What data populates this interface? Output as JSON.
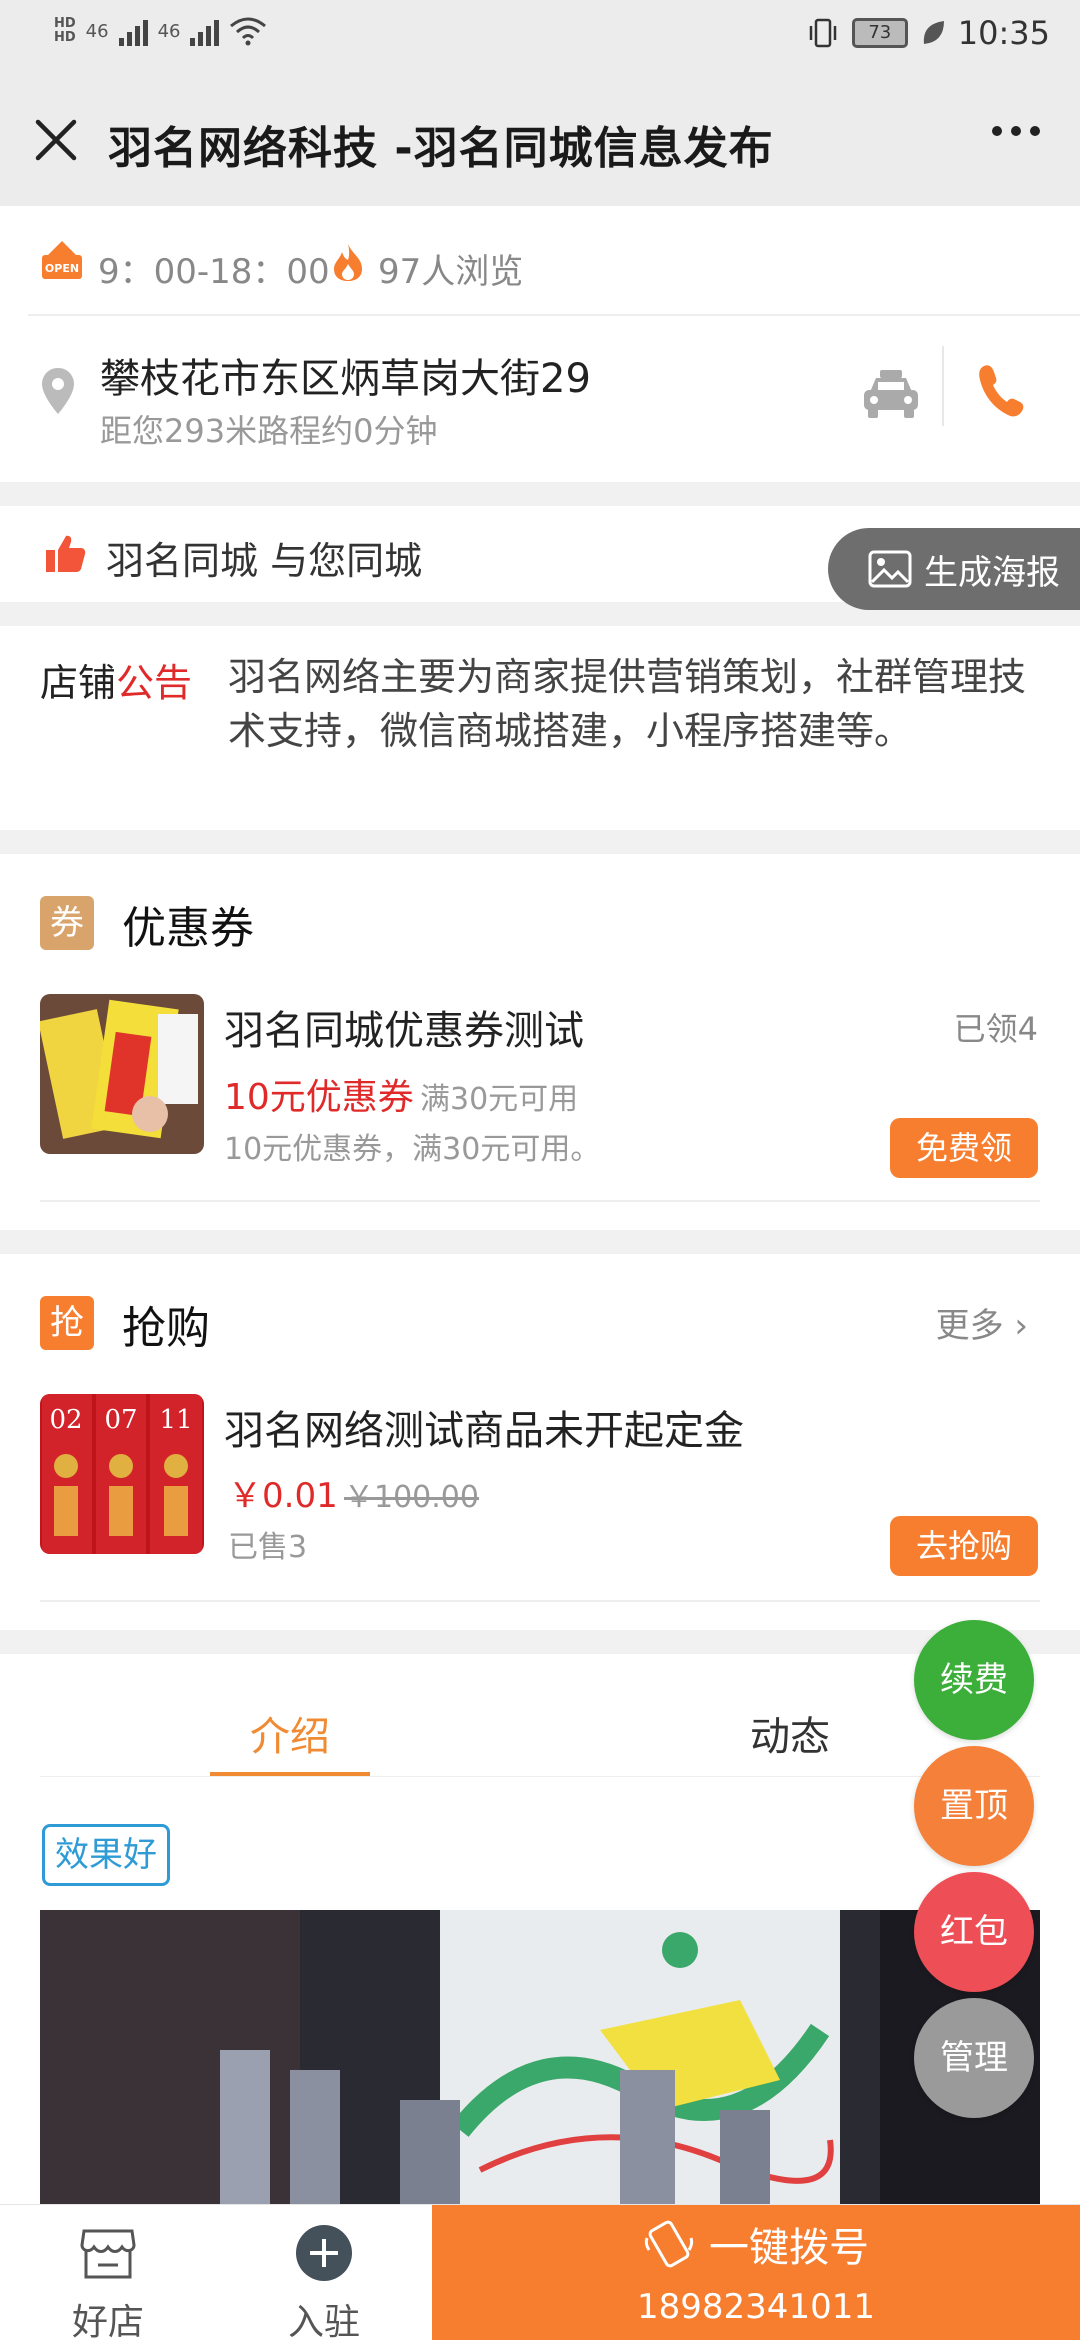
{
  "status_bar": {
    "signal_1": "46",
    "signal_2": "46",
    "battery": "73",
    "time": "10:35"
  },
  "nav": {
    "title": "羽名网络科技 -羽名同城信息发布"
  },
  "shop": {
    "open_badge": "OPEN",
    "hours": "9：00-18：00",
    "views": "97人浏览",
    "address": "攀枝花市东区炳草岗大街29",
    "distance": "距您293米路程约0分钟",
    "slogan": "羽名同城 与您同城",
    "poster_button": "生成海报",
    "notice_label_1": "店铺",
    "notice_label_2": "公告",
    "notice_text": "羽名网络主要为商家提供营销策划，社群管理技术支持，微信商城搭建，小程序搭建等。"
  },
  "coupon_section": {
    "badge": "券",
    "title": "优惠券",
    "item": {
      "name": "羽名同城优惠券测试",
      "claimed": "已领4",
      "amount": "10元优惠券",
      "condition": "满30元可用",
      "description": "10元优惠券，满30元可用。",
      "button": "免费领"
    }
  },
  "flash_section": {
    "badge": "抢",
    "title": "抢购",
    "more": "更多",
    "item": {
      "name": "羽名网络测试商品未开起定金",
      "price": "￥0.01",
      "old_price": "￥100.00",
      "sold": "已售3",
      "button": "去抢购"
    }
  },
  "tabs": [
    "介绍",
    "动态"
  ],
  "intro": {
    "tag": "效果好"
  },
  "fabs": {
    "renew": "续费",
    "top": "置顶",
    "redpacket": "红包",
    "manage": "管理"
  },
  "bottom": {
    "shops": "好店",
    "join": "入驻",
    "call": "一键拨号",
    "phone": "18982341011"
  },
  "colors": {
    "accent": "#f77d2f",
    "price_red": "#e02a2a",
    "fab_green": "#3cae3a",
    "fab_orange": "#f5803a",
    "fab_red": "#ee4e56",
    "fab_gray": "#9a9a9a",
    "tag_blue": "#2e9bd6"
  }
}
